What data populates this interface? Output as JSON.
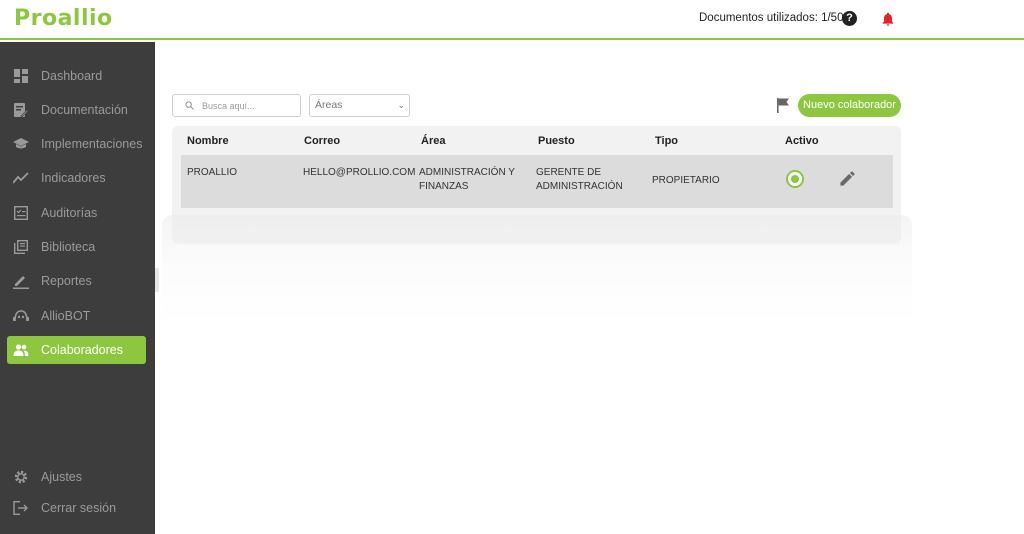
{
  "header": {
    "logo": "Proallio",
    "docs_usage": "Documentos utilizados: 1/50",
    "help_glyph": "?"
  },
  "sidebar": {
    "items": [
      {
        "label": "Dashboard",
        "icon": "dashboard-icon"
      },
      {
        "label": "Documentación",
        "icon": "document-edit-icon"
      },
      {
        "label": "Implementaciones",
        "icon": "graduation-cap-icon"
      },
      {
        "label": "Indicadores",
        "icon": "line-chart-icon"
      },
      {
        "label": "Auditorías",
        "icon": "checklist-icon"
      },
      {
        "label": "Biblioteca",
        "icon": "library-icon"
      },
      {
        "label": "Reportes",
        "icon": "pen-icon"
      },
      {
        "label": "AllioBOT",
        "icon": "robot-icon"
      },
      {
        "label": "Colaboradores",
        "icon": "people-icon",
        "active": true
      }
    ],
    "bottom": [
      {
        "label": "Ajustes",
        "icon": "gear-icon"
      },
      {
        "label": "Cerrar sesión",
        "icon": "logout-icon"
      }
    ]
  },
  "toolbar": {
    "search_placeholder": "Busca aquí...",
    "areas_selected": "Áreas",
    "new_button": "Nuevo colaborador"
  },
  "table": {
    "headers": [
      "Nombre",
      "Correo",
      "Área",
      "Puesto",
      "Tipo",
      "Activo"
    ],
    "rows": [
      {
        "nombre": "PROALLIO",
        "correo": "HELLO@PROLLIO.COM",
        "area_line1": "ADMINISTRACIÓN Y",
        "area_line2": "FINANZAS",
        "puesto_line1": "GERENTE DE",
        "puesto_line2": "ADMINISTRACIÓN",
        "tipo": "PROPIETARIO",
        "activo": true
      }
    ]
  },
  "colors": {
    "accent": "#8dc63f",
    "sidebar_bg": "#3d3d3d",
    "bell": "#e0242a"
  }
}
